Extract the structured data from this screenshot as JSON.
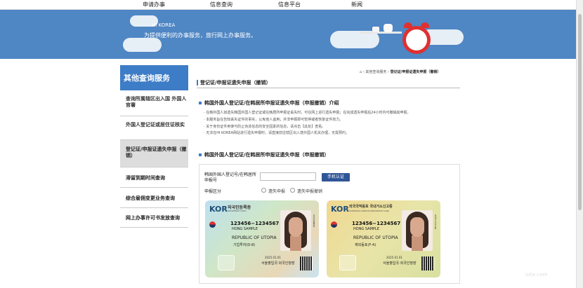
{
  "topnav": {
    "items": [
      "申请办事",
      "信息查询",
      "信息平台",
      "新闻"
    ]
  },
  "banner": {
    "title": "HI KOREA",
    "subtitle": "为提供便利的办事服务，旅行网上办事服务。"
  },
  "sidebar": {
    "heading": "其他查询服务",
    "items": [
      {
        "label": "查询所属辖区出入国 外国人官署"
      },
      {
        "label": "外国人登记证或居住证核实"
      },
      {
        "label": "登记证/申报证遗失申报（撤销）"
      },
      {
        "label": "滞留到期时间查询"
      },
      {
        "label": "综合雇佣变更业务查询"
      },
      {
        "label": "网上办事许可书发放查询"
      }
    ],
    "active_index": 2
  },
  "breadcrumb": {
    "parent": "其他查询服务",
    "current": "登记证/申报证遗失申报（撤销）"
  },
  "page": {
    "title": "登记证/申报证遗失申报（撤销）",
    "intro_heading": "韩国外国人登记证/在韩居所申报证遗失申报（申报撤销）介绍",
    "notes": [
      "在韩外国人如遗失韩国外国人登记证或在韩居所申报证丢失时，可在网上进行遗失申报；在完成遗失申报后24小时内可撤销其申报。",
      "本服务旨在告知丢失证件的事实，以免他人盗用；并非申报即可暂停或者恢复证件效力。",
      "关于身份证件用使与防止伪造信息的安全因素的信息，请点击【此处】查看。",
      "无法在HI KOREA网站进行遗失申报时，请直接前往辖区出入境外国人机关办理，无需预约。"
    ],
    "form_heading": "韩国外国人登记证/在韩居所申报证遗失申报（申报撤销）"
  },
  "form": {
    "id_label_line1": "韩国外国人登记号/在韩居所",
    "id_label_line2": "申报号",
    "id_value": "",
    "verify_button": "手机认证",
    "type_label": "申报区分",
    "radio_options": [
      "遗失申报",
      "遗失申报撤销"
    ]
  },
  "cards": [
    {
      "kor": "KOR",
      "title_ko": "외국인등록증",
      "subtitle": "RESIDENCE CARD",
      "number": "123456−1234567",
      "name": "HONG SAMPLE",
      "nationality": "REPUBLIC OF UTOPIA",
      "status": "기업투자(D-8)",
      "issue_date": "2025.01.01",
      "office": "서울출입국·외국인청장",
      "side_text": "외국인등록증"
    },
    {
      "kor": "KOR",
      "title_ko": "외국국적동포 국내거소신고증",
      "subtitle": "OVERSEAS KOREAN RESIDENCE CARD",
      "number": "123456−1234567",
      "name": "HONG SAMPLE",
      "nationality": "REPUBLIC OF UTOPIA",
      "status": "재외동포(F-4)",
      "issue_date": "2025.01.01",
      "office": "서울출입국·외국인청장",
      "side_text": "국내거소신고증"
    }
  ],
  "watermark": "iolix.com",
  "colors": {
    "brand_blue": "#3d7cc6",
    "banner_blue": "#4f86c4",
    "button_navy": "#2f5597",
    "clock_red": "#e03030"
  }
}
